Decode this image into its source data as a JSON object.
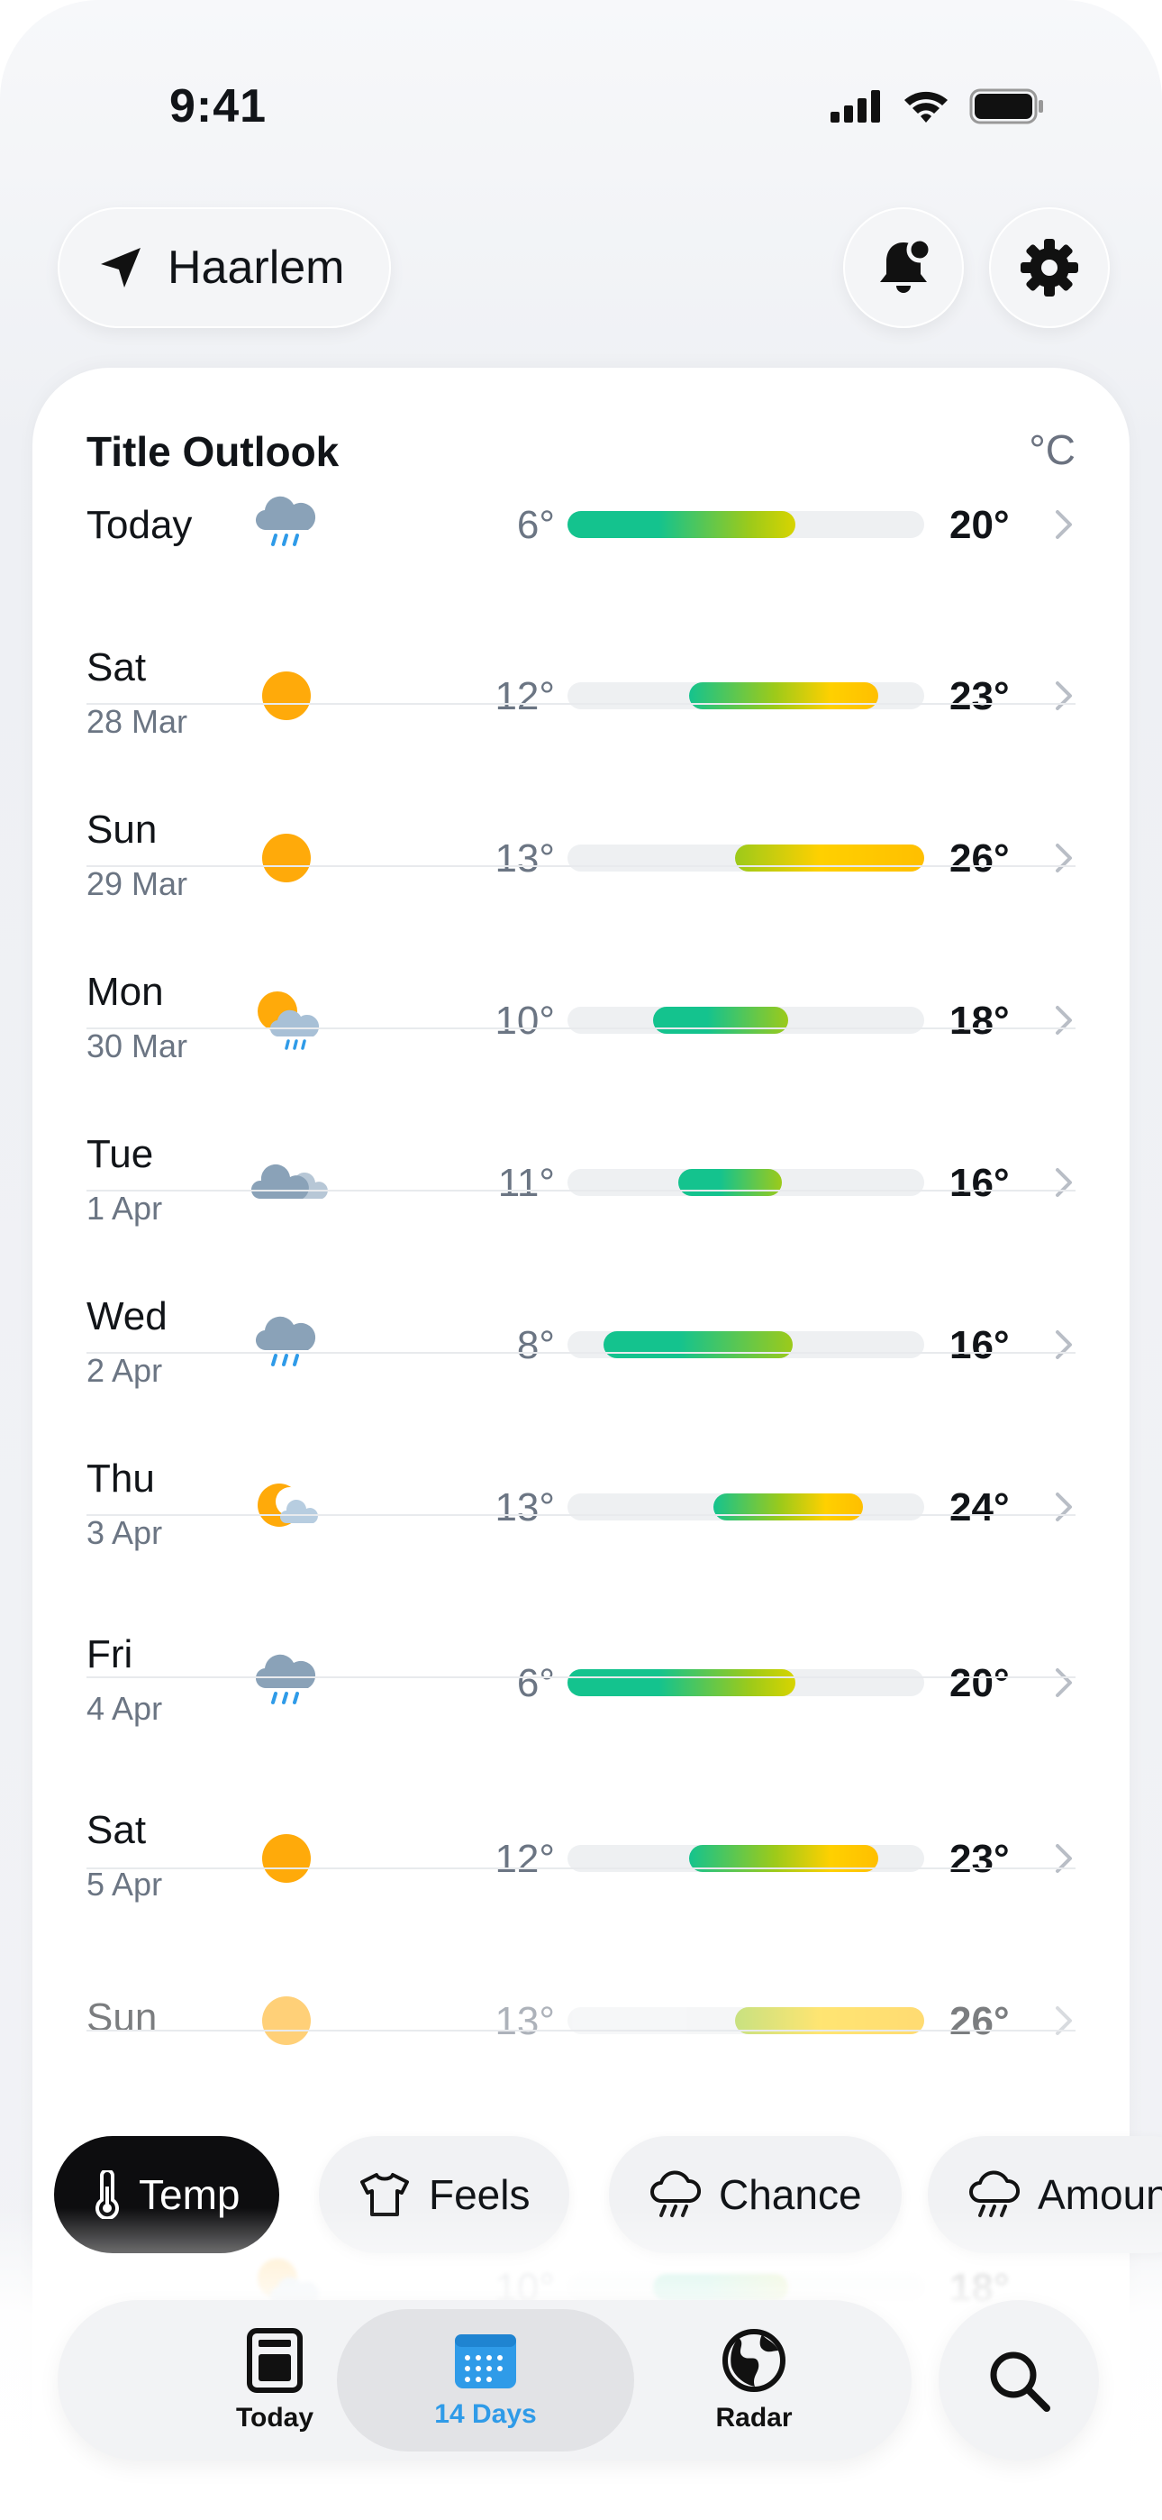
{
  "status_bar": {
    "time": "9:41",
    "icons": [
      "signal-icon",
      "wifi-icon",
      "battery-icon"
    ]
  },
  "header": {
    "location": "Haarlem",
    "location_icon": "navigation-arrow-icon",
    "notification_icon": "bell-badge-icon",
    "settings_icon": "gear-icon"
  },
  "card": {
    "title": "Title Outlook",
    "unit": "°C",
    "rows": [
      {
        "day": "Today",
        "date": "",
        "icon": "rain",
        "low": "6°",
        "high": "20°",
        "bar_start": 0.0,
        "bar_end": 0.64,
        "gradient": "green-yellow"
      },
      {
        "day": "Sat",
        "date": "28 Mar",
        "icon": "sun",
        "low": "12°",
        "high": "23°",
        "bar_start": 0.34,
        "bar_end": 0.87,
        "gradient": "green-gold"
      },
      {
        "day": "Sun",
        "date": "29 Mar",
        "icon": "sun",
        "low": "13°",
        "high": "26°",
        "bar_start": 0.47,
        "bar_end": 1.0,
        "gradient": "lime-gold"
      },
      {
        "day": "Mon",
        "date": "30 Mar",
        "icon": "sun-rain",
        "low": "10°",
        "high": "18°",
        "bar_start": 0.24,
        "bar_end": 0.62,
        "gradient": "green-lime"
      },
      {
        "day": "Tue",
        "date": "1 Apr",
        "icon": "cloudy",
        "low": "11°",
        "high": "16°",
        "bar_start": 0.31,
        "bar_end": 0.6,
        "gradient": "green-lime"
      },
      {
        "day": "Wed",
        "date": "2 Apr",
        "icon": "rain",
        "low": "8°",
        "high": "16°",
        "bar_start": 0.1,
        "bar_end": 0.63,
        "gradient": "green-lime"
      },
      {
        "day": "Thu",
        "date": "3 Apr",
        "icon": "moon-cloud",
        "low": "13°",
        "high": "24°",
        "bar_start": 0.41,
        "bar_end": 0.83,
        "gradient": "green-gold"
      },
      {
        "day": "Fri",
        "date": "4 Apr",
        "icon": "rain",
        "low": "6°",
        "high": "20°",
        "bar_start": 0.0,
        "bar_end": 0.64,
        "gradient": "green-yellow"
      },
      {
        "day": "Sat",
        "date": "5 Apr",
        "icon": "sun",
        "low": "12°",
        "high": "23°",
        "bar_start": 0.34,
        "bar_end": 0.87,
        "gradient": "green-gold"
      },
      {
        "day": "Sun",
        "date": "",
        "icon": "sun",
        "low": "13°",
        "high": "26°",
        "bar_start": 0.47,
        "bar_end": 1.0,
        "gradient": "lime-gold"
      }
    ],
    "partial_row": {
      "icon": "sun-rain",
      "low": "10°",
      "high": "18°",
      "bar_start": 0.24,
      "bar_end": 0.62,
      "gradient": "green-lime"
    }
  },
  "chips": [
    {
      "label": "Temp",
      "icon": "thermometer-icon",
      "active": true
    },
    {
      "label": "Feels",
      "icon": "tshirt-icon",
      "active": false
    },
    {
      "label": "Chance",
      "icon": "rain-cloud-icon",
      "active": false
    },
    {
      "label": "Amoun",
      "icon": "rain-cloud-icon",
      "active": false
    }
  ],
  "tabbar": {
    "tabs": [
      {
        "label": "Today",
        "icon": "document-icon",
        "active": false
      },
      {
        "label": "14 Days",
        "icon": "calendar-icon",
        "active": true
      },
      {
        "label": "Radar",
        "icon": "globe-icon",
        "active": false
      }
    ],
    "search_icon": "search-icon"
  },
  "colors": {
    "accent_blue": "#2f9be8",
    "sun": "#ffaa0a",
    "cloud": "#8aa2b8",
    "rain_drop": "#2f9be8",
    "bar_green": "#14c38e",
    "bar_yellow": "#ffd000",
    "bar_gold": "#ffbf00",
    "bar_lime": "#9cca1a"
  }
}
